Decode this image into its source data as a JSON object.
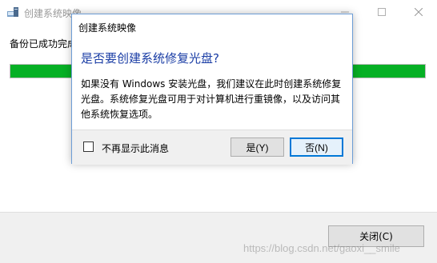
{
  "background_window": {
    "title": "创建系统映像",
    "status_text": "备份已成功完成",
    "progress_fraction": 1.0,
    "close_button": "关闭(C)"
  },
  "dialog": {
    "title": "创建系统映像",
    "heading": "是否要创建系统修复光盘?",
    "body": "如果没有 Windows 安装光盘，我们建议在此时创建系统修复光盘。系统修复光盘可用于对计算机进行重镜像，以及访问其他系统恢复选项。",
    "checkbox_label": "不再显示此消息",
    "checkbox_checked": false,
    "yes_button": "是(Y)",
    "no_button": "否(N)"
  },
  "watermark": "https://blog.csdn.net/gaoxi__smile",
  "colors": {
    "progress": "#06b025",
    "heading": "#1a3da5",
    "focus_border": "#0078d7"
  }
}
